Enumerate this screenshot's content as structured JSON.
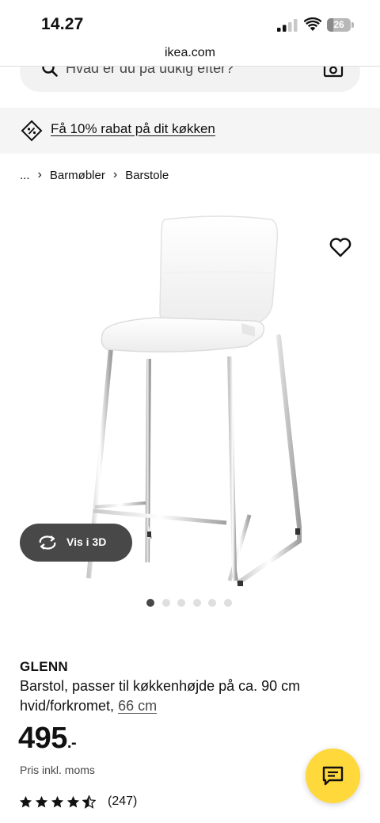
{
  "status_bar": {
    "time": "14.27",
    "battery_level": "26"
  },
  "browser": {
    "url": "ikea.com"
  },
  "search": {
    "placeholder": "Hvad er du på udkig efter?"
  },
  "promo": {
    "text": "Få 10% rabat på dit køkken"
  },
  "breadcrumb": {
    "ellipsis": "...",
    "items": [
      "Barmøbler",
      "Barstole"
    ]
  },
  "gallery": {
    "view_3d_label": "Vis i 3D",
    "image_count": 6,
    "active_index": 0
  },
  "product": {
    "name": "GLENN",
    "description": "Barstol, passer til køkkenhøjde på ca. 90 cm",
    "variant": "hvid/forkromet,",
    "size": "66 cm",
    "price": "495",
    "price_suffix": ".-",
    "price_note": "Pris inkl. moms",
    "rating": 4.5,
    "rating_count": "(247)"
  },
  "icons": {
    "search": "search-icon",
    "camera": "camera-icon",
    "promo": "discount-tag-icon",
    "favorite": "heart-icon",
    "view3d": "rotate-3d-icon",
    "chat": "chat-icon"
  },
  "colors": {
    "chat_button": "#ffd83b",
    "dark_button": "#484848"
  }
}
